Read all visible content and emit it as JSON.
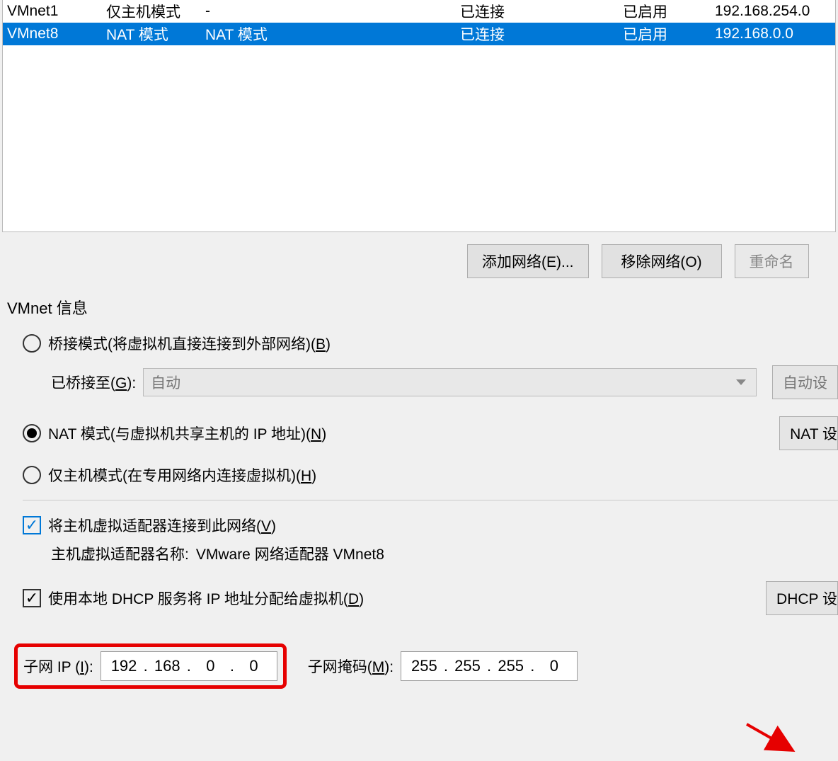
{
  "table": {
    "rows": [
      {
        "name": "VMnet1",
        "type": "仅主机模式",
        "ext": "-",
        "conn": "已连接",
        "dhcp": "已启用",
        "subnet": "192.168.254.0"
      },
      {
        "name": "VMnet8",
        "type": "NAT 模式",
        "ext": "NAT 模式",
        "conn": "已连接",
        "dhcp": "已启用",
        "subnet": "192.168.0.0"
      }
    ]
  },
  "buttons": {
    "add_network": "添加网络(E)...",
    "remove_network": "移除网络(O)",
    "rename_network": "重命名"
  },
  "info": {
    "title": "VMnet 信息",
    "bridge_label_pre": "桥接模式(将虚拟机直接连接到外部网络)(",
    "bridge_hotkey": "B",
    "bridge_label_post": ")",
    "bridged_to_pre": "已桥接至(",
    "bridged_to_hotkey": "G",
    "bridged_to_post": "):",
    "bridged_select": "自动",
    "auto_settings": "自动设",
    "nat_label_pre": "NAT 模式(与虚拟机共享主机的 IP 地址)(",
    "nat_hotkey": "N",
    "nat_label_post": ")",
    "nat_settings": "NAT 设",
    "hostonly_label_pre": "仅主机模式(在专用网络内连接虚拟机)(",
    "hostonly_hotkey": "H",
    "hostonly_label_post": ")",
    "connect_adapter_pre": "将主机虚拟适配器连接到此网络(",
    "connect_adapter_hotkey": "V",
    "connect_adapter_post": ")",
    "adapter_name_label": "主机虚拟适配器名称: ",
    "adapter_name_value": "VMware 网络适配器 VMnet8",
    "dhcp_label_pre": "使用本地 DHCP 服务将 IP 地址分配给虚拟机(",
    "dhcp_hotkey": "D",
    "dhcp_label_post": ")",
    "dhcp_settings": "DHCP 设",
    "subnet_ip_label_pre": "子网 IP (",
    "subnet_ip_hotkey": "I",
    "subnet_ip_label_post": "):",
    "subnet_ip": {
      "o1": "192",
      "o2": "168",
      "o3": "0",
      "o4": "0"
    },
    "subnet_mask_label_pre": "子网掩码(",
    "subnet_mask_hotkey": "M",
    "subnet_mask_label_post": "):",
    "subnet_mask": {
      "o1": "255",
      "o2": "255",
      "o3": "255",
      "o4": "0"
    }
  }
}
